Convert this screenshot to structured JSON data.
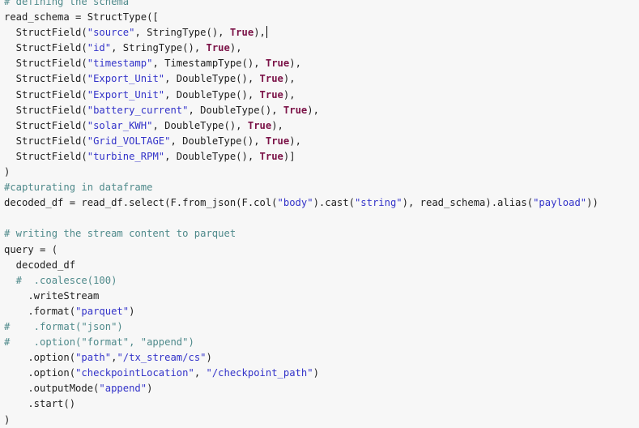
{
  "editor": {
    "colors": {
      "background": "#f7f7f7",
      "text": "#1e1e1e",
      "comment": "#4f8a8b",
      "string": "#3333c9",
      "keyword": "#7b1247"
    },
    "lines": [
      [
        {
          "t": "# defining the schema",
          "c": "cm"
        }
      ],
      [
        {
          "t": "read_schema = StructType(["
        }
      ],
      [
        {
          "t": "  StructField("
        },
        {
          "t": "\"source\"",
          "c": "str"
        },
        {
          "t": ", StringType(), "
        },
        {
          "t": "True",
          "c": "kw"
        },
        {
          "t": "),"
        },
        {
          "caret": true
        }
      ],
      [
        {
          "t": "  StructField("
        },
        {
          "t": "\"id\"",
          "c": "str"
        },
        {
          "t": ", StringType(), "
        },
        {
          "t": "True",
          "c": "kw"
        },
        {
          "t": "),"
        }
      ],
      [
        {
          "t": "  StructField("
        },
        {
          "t": "\"timestamp\"",
          "c": "str"
        },
        {
          "t": ", TimestampType(), "
        },
        {
          "t": "True",
          "c": "kw"
        },
        {
          "t": "),"
        }
      ],
      [
        {
          "t": "  StructField("
        },
        {
          "t": "\"Export_Unit\"",
          "c": "str"
        },
        {
          "t": ", DoubleType(), "
        },
        {
          "t": "True",
          "c": "kw"
        },
        {
          "t": "),"
        }
      ],
      [
        {
          "t": "  StructField("
        },
        {
          "t": "\"Export_Unit\"",
          "c": "str"
        },
        {
          "t": ", DoubleType(), "
        },
        {
          "t": "True",
          "c": "kw"
        },
        {
          "t": "),"
        }
      ],
      [
        {
          "t": "  StructField("
        },
        {
          "t": "\"battery_current\"",
          "c": "str"
        },
        {
          "t": ", DoubleType(), "
        },
        {
          "t": "True",
          "c": "kw"
        },
        {
          "t": "),"
        }
      ],
      [
        {
          "t": "  StructField("
        },
        {
          "t": "\"solar_KWH\"",
          "c": "str"
        },
        {
          "t": ", DoubleType(), "
        },
        {
          "t": "True",
          "c": "kw"
        },
        {
          "t": "),"
        }
      ],
      [
        {
          "t": "  StructField("
        },
        {
          "t": "\"Grid_VOLTAGE\"",
          "c": "str"
        },
        {
          "t": ", DoubleType(), "
        },
        {
          "t": "True",
          "c": "kw"
        },
        {
          "t": "),"
        }
      ],
      [
        {
          "t": "  StructField("
        },
        {
          "t": "\"turbine_RPM\"",
          "c": "str"
        },
        {
          "t": ", DoubleType(), "
        },
        {
          "t": "True",
          "c": "kw"
        },
        {
          "t": ")]"
        }
      ],
      [
        {
          "t": ")"
        }
      ],
      [
        {
          "t": "#capturating in dataframe",
          "c": "cm"
        }
      ],
      [
        {
          "t": "decoded_df = read_df.select(F.from_json(F.col("
        },
        {
          "t": "\"body\"",
          "c": "str"
        },
        {
          "t": ").cast("
        },
        {
          "t": "\"string\"",
          "c": "str"
        },
        {
          "t": "), read_schema).alias("
        },
        {
          "t": "\"payload\"",
          "c": "str"
        },
        {
          "t": "))"
        }
      ],
      [
        {
          "t": ""
        }
      ],
      [
        {
          "t": "# writing the stream content to parquet",
          "c": "cm"
        }
      ],
      [
        {
          "t": "query = ("
        }
      ],
      [
        {
          "t": "  decoded_df"
        }
      ],
      [
        {
          "t": "  #  .coalesce(100)",
          "c": "cm"
        }
      ],
      [
        {
          "t": "    .writeStream"
        }
      ],
      [
        {
          "t": "    .format("
        },
        {
          "t": "\"parquet\"",
          "c": "str"
        },
        {
          "t": ")"
        }
      ],
      [
        {
          "t": "#    .format(\"json\")",
          "c": "cm"
        }
      ],
      [
        {
          "t": "#    .option(\"format\", \"append\")",
          "c": "cm"
        }
      ],
      [
        {
          "t": "    .option("
        },
        {
          "t": "\"path\"",
          "c": "str"
        },
        {
          "t": ","
        },
        {
          "t": "\"/tx_stream/cs\"",
          "c": "str"
        },
        {
          "t": ")"
        }
      ],
      [
        {
          "t": "    .option("
        },
        {
          "t": "\"checkpointLocation\"",
          "c": "str"
        },
        {
          "t": ", "
        },
        {
          "t": "\"/checkpoint_path\"",
          "c": "str"
        },
        {
          "t": ")"
        }
      ],
      [
        {
          "t": "    .outputMode("
        },
        {
          "t": "\"append\"",
          "c": "str"
        },
        {
          "t": ")"
        }
      ],
      [
        {
          "t": "    .start()"
        }
      ],
      [
        {
          "t": ")"
        }
      ]
    ]
  }
}
